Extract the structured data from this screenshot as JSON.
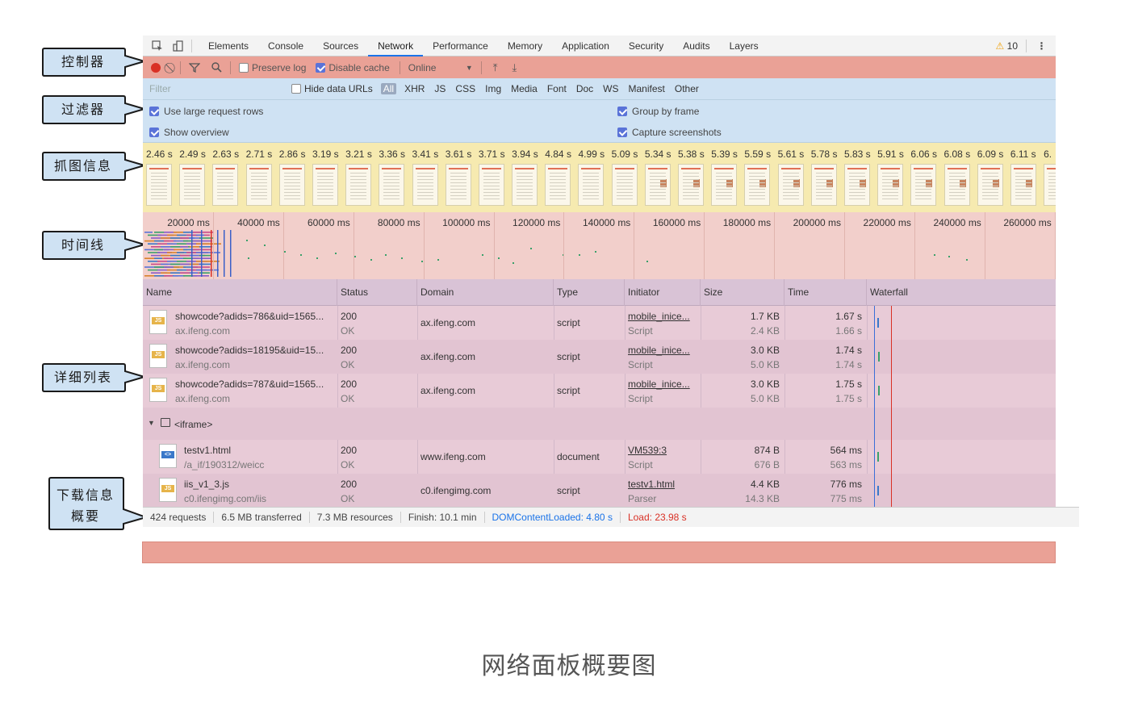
{
  "tabbar": {
    "tabs": [
      "Elements",
      "Console",
      "Sources",
      "Network",
      "Performance",
      "Memory",
      "Application",
      "Security",
      "Audits",
      "Layers"
    ],
    "active_tab": "Network",
    "warnings": "10"
  },
  "callouts": [
    "控制器",
    "过滤器",
    "抓图信息",
    "时间线",
    "详细列表",
    "下载信息\n概要"
  ],
  "control": {
    "preserve_log": "Preserve log",
    "disable_cache": "Disable cache",
    "throttle": "Online"
  },
  "filter": {
    "placeholder": "Filter",
    "hide_data_urls": "Hide data URLs",
    "types": [
      "All",
      "XHR",
      "JS",
      "CSS",
      "Img",
      "Media",
      "Font",
      "Doc",
      "WS",
      "Manifest",
      "Other"
    ],
    "use_large_rows": "Use large request rows",
    "show_overview": "Show overview",
    "group_by_frame": "Group by frame",
    "capture_screenshots": "Capture screenshots"
  },
  "screenshots": {
    "times": [
      "2.46 s",
      "2.49 s",
      "2.63 s",
      "2.71 s",
      "2.86 s",
      "3.19 s",
      "3.21 s",
      "3.36 s",
      "3.41 s",
      "3.61 s",
      "3.71 s",
      "3.94 s",
      "4.84 s",
      "4.99 s",
      "5.09 s",
      "5.34 s",
      "5.38 s",
      "5.39 s",
      "5.59 s",
      "5.61 s",
      "5.78 s",
      "5.83 s",
      "5.91 s",
      "6.06 s",
      "6.08 s",
      "6.09 s",
      "6.11 s",
      "6."
    ]
  },
  "timeline": {
    "ticks": [
      "20000 ms",
      "40000 ms",
      "60000 ms",
      "80000 ms",
      "100000 ms",
      "120000 ms",
      "140000 ms",
      "160000 ms",
      "180000 ms",
      "200000 ms",
      "220000 ms",
      "240000 ms",
      "260000 ms"
    ]
  },
  "table": {
    "headers": [
      "Name",
      "Status",
      "Domain",
      "Type",
      "Initiator",
      "Size",
      "Time",
      "Waterfall"
    ],
    "rows": [
      {
        "name": "showcode?adids=786&uid=1565...",
        "path": "ax.ifeng.com",
        "status": "200",
        "status_text": "OK",
        "domain": "ax.ifeng.com",
        "type": "script",
        "initiator": "mobile_inice...",
        "initiator_type": "Script",
        "size": "1.7 KB",
        "resource": "2.4 KB",
        "time": "1.67 s",
        "latency": "1.66 s",
        "icon": "js-file-icon"
      },
      {
        "name": "showcode?adids=18195&uid=15...",
        "path": "ax.ifeng.com",
        "status": "200",
        "status_text": "OK",
        "domain": "ax.ifeng.com",
        "type": "script",
        "initiator": "mobile_inice...",
        "initiator_type": "Script",
        "size": "3.0 KB",
        "resource": "5.0 KB",
        "time": "1.74 s",
        "latency": "1.74 s",
        "icon": "js-file-icon"
      },
      {
        "name": "showcode?adids=787&uid=1565...",
        "path": "ax.ifeng.com",
        "status": "200",
        "status_text": "OK",
        "domain": "ax.ifeng.com",
        "type": "script",
        "initiator": "mobile_inice...",
        "initiator_type": "Script",
        "size": "3.0 KB",
        "resource": "5.0 KB",
        "time": "1.75 s",
        "latency": "1.75 s",
        "icon": "js-file-icon"
      }
    ],
    "group_label": "<iframe>",
    "group_rows": [
      {
        "name": "testv1.html",
        "path": "/a_if/190312/weicc",
        "status": "200",
        "status_text": "OK",
        "domain": "www.ifeng.com",
        "type": "document",
        "initiator": "VM539:3",
        "initiator_type": "Script",
        "size": "874 B",
        "resource": "676 B",
        "time": "564 ms",
        "latency": "563 ms",
        "icon": "html-file-icon"
      },
      {
        "name": "iis_v1_3.js",
        "path": "c0.ifengimg.com/iis",
        "status": "200",
        "status_text": "OK",
        "domain": "c0.ifengimg.com",
        "type": "script",
        "initiator": "testv1.html",
        "initiator_type": "Parser",
        "size": "4.4 KB",
        "resource": "14.3 KB",
        "time": "776 ms",
        "latency": "775 ms",
        "icon": "js-file-icon"
      }
    ]
  },
  "status": {
    "requests": "424 requests",
    "transferred": "6.5 MB transferred",
    "resources": "7.3 MB resources",
    "finish": "Finish: 10.1 min",
    "dom_content_loaded": "DOMContentLoaded: 4.80 s",
    "load": "Load: 23.98 s"
  },
  "caption": "网络面板概要图",
  "colors": {
    "control_bg": "#eaa196",
    "filter_bg": "#cfe2f3",
    "screens_bg": "#f6eab0",
    "timeline_bg": "#f2cfcb",
    "table_bg": "#e8cbd7",
    "callout_bg": "#cfe2f3",
    "accent_blue": "#1a73e8",
    "load_red": "#d93025"
  }
}
